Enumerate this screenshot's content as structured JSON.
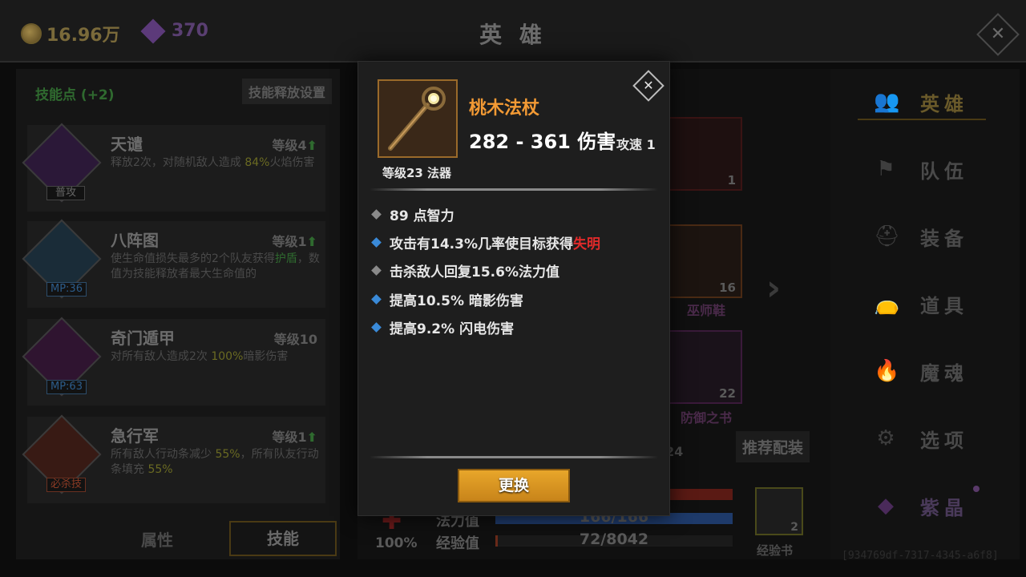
{
  "currency": {
    "gold": "16.96万",
    "gems": "370"
  },
  "header": {
    "title": "英 雄"
  },
  "skills_panel": {
    "points_label": "技能点 (+2)",
    "setting_label": "技能释放设置",
    "skills": [
      {
        "name": "天谴",
        "level": "等级4",
        "upgrade": "⬆",
        "badge": "普攻",
        "desc_a": "释放2次，对随机敌人造成 ",
        "desc_hl": "84%",
        "desc_b": "火焰伤害"
      },
      {
        "name": "八阵图",
        "level": "等级1",
        "upgrade": "⬆",
        "badge": "MP:36",
        "desc_a": "使生命值损失最多的2个队友获得",
        "desc_hl": "护盾",
        "desc_b": "，数值为技能释放者最大生命值的"
      },
      {
        "name": "奇门遁甲",
        "level": "等级10",
        "upgrade": "",
        "badge": "MP:63",
        "desc_a": "对所有敌人造成2次 ",
        "desc_hl": "100%",
        "desc_b": "暗影伤害"
      },
      {
        "name": "急行军",
        "level": "等级1",
        "upgrade": "⬆",
        "badge": "必杀技",
        "desc_a": "所有敌人行动条减少 ",
        "desc_hl": "55%",
        "desc_b": "，所有队友行动条填充 ",
        "desc_hl2": "55%"
      }
    ],
    "tab_attr": "属性",
    "tab_skill": "技能"
  },
  "center": {
    "slots": [
      {
        "count": "1",
        "name": ""
      },
      {
        "count": "16",
        "name": "巫师鞋"
      },
      {
        "count": "22",
        "name": "防御之书"
      }
    ],
    "partial_number": "24",
    "recommend_label": "推荐配装",
    "stats": [
      {
        "label": "法力值",
        "value": "166/166",
        "ratio": 1.0,
        "color": "#1e3a6a"
      },
      {
        "label": "经验值",
        "value": "72/8042",
        "ratio": 0.009,
        "color": "#6a2a1a"
      }
    ],
    "crit_pct": "100%",
    "exp_book": {
      "count": "2",
      "label": "经验书"
    }
  },
  "nav": {
    "items": [
      {
        "label": "英雄",
        "icon": "👥",
        "active": true
      },
      {
        "label": "队伍",
        "icon": "⚑",
        "active": false
      },
      {
        "label": "装备",
        "icon": "⛑",
        "active": false
      },
      {
        "label": "道具",
        "icon": "👝",
        "active": false
      },
      {
        "label": "魔魂",
        "icon": "🔥",
        "active": false
      },
      {
        "label": "选项",
        "icon": "⚙",
        "active": false
      },
      {
        "label": "紫晶",
        "icon": "◆",
        "active": false
      }
    ]
  },
  "watermark": "[934769df-7317-4345-a6f8]",
  "popup": {
    "item_name": "桃木法杖",
    "damage": "282 - 361 伤害",
    "attack_speed": "攻速 1",
    "meta": "等级23 法器",
    "attributes": [
      {
        "bullet": "gray",
        "text": "89 点智力",
        "highlight": ""
      },
      {
        "bullet": "blue",
        "text": "攻击有14.3%几率使目标获得",
        "highlight": "失明"
      },
      {
        "bullet": "gray",
        "text": "击杀敌人回复15.6%法力值",
        "highlight": ""
      },
      {
        "bullet": "blue",
        "text": "提高10.5% 暗影伤害",
        "highlight": ""
      },
      {
        "bullet": "blue",
        "text": "提高9.2% 闪电伤害",
        "highlight": ""
      }
    ],
    "replace_button": "更换",
    "close_icon": "close-icon"
  }
}
